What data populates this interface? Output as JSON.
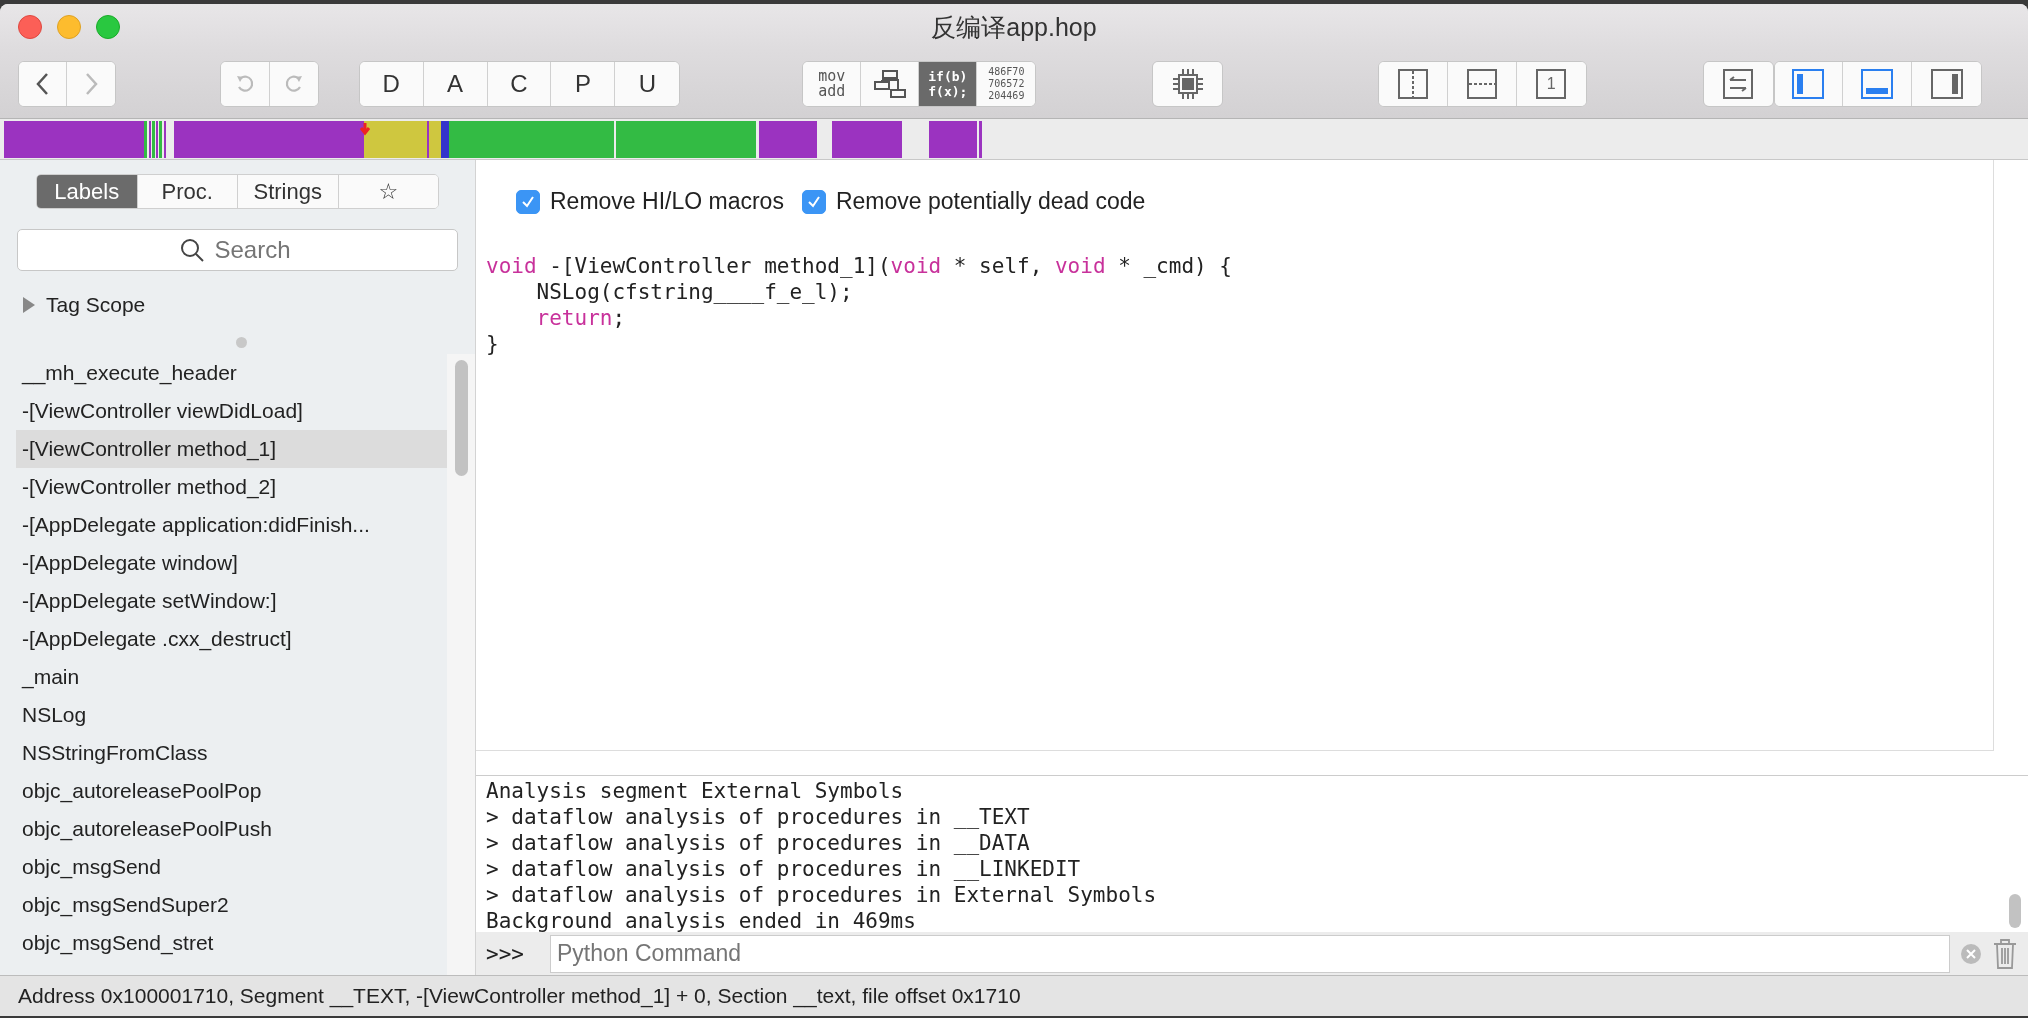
{
  "window": {
    "title": "反编译app.hop"
  },
  "toolbar": {
    "navigation": [
      {
        "kind": "back",
        "disabled": false
      },
      {
        "kind": "forward",
        "disabled": true
      }
    ],
    "history": [
      {
        "kind": "undo",
        "disabled": true
      },
      {
        "kind": "redo",
        "disabled": true
      }
    ],
    "letter_buttons": [
      "D",
      "A",
      "C",
      "P",
      "U"
    ],
    "modes": [
      {
        "kind": "asm",
        "lines": [
          "mov",
          "add"
        ],
        "selected": false
      },
      {
        "kind": "graph",
        "selected": false
      },
      {
        "kind": "pseudo",
        "lines": [
          "if(b)",
          "f(x);"
        ],
        "selected": true
      },
      {
        "kind": "hex",
        "lines": [
          "486F70",
          "706572",
          "204469"
        ],
        "selected": false
      }
    ],
    "views": [
      {
        "kind": "vsplit"
      },
      {
        "kind": "hsplit"
      },
      {
        "kind": "single",
        "label": "1"
      }
    ],
    "panels": [
      {
        "kind": "left",
        "selected": true
      },
      {
        "kind": "bottom",
        "selected": true
      },
      {
        "kind": "right",
        "selected": false
      }
    ]
  },
  "sidebar": {
    "tabs": [
      {
        "label": "Labels",
        "selected": true
      },
      {
        "label": "Proc.",
        "selected": false
      },
      {
        "label": "Strings",
        "selected": false
      },
      {
        "label": "☆",
        "selected": false
      }
    ],
    "search": {
      "placeholder": "Search"
    },
    "tag_scope": {
      "label": "Tag Scope",
      "expanded": false
    },
    "items": [
      {
        "label": "__mh_execute_header",
        "selected": false
      },
      {
        "label": "-[ViewController viewDidLoad]",
        "selected": false
      },
      {
        "label": "-[ViewController method_1]",
        "selected": true
      },
      {
        "label": "-[ViewController method_2]",
        "selected": false
      },
      {
        "label": "-[AppDelegate application:didFinish...",
        "selected": false
      },
      {
        "label": "-[AppDelegate window]",
        "selected": false
      },
      {
        "label": "-[AppDelegate setWindow:]",
        "selected": false
      },
      {
        "label": "-[AppDelegate .cxx_destruct]",
        "selected": false
      },
      {
        "label": "_main",
        "selected": false
      },
      {
        "label": "NSLog",
        "selected": false
      },
      {
        "label": "NSStringFromClass",
        "selected": false
      },
      {
        "label": "objc_autoreleasePoolPop",
        "selected": false
      },
      {
        "label": "objc_autoreleasePoolPush",
        "selected": false
      },
      {
        "label": "objc_msgSend",
        "selected": false
      },
      {
        "label": "objc_msgSendSuper2",
        "selected": false
      },
      {
        "label": "objc_msgSend_stret",
        "selected": false
      }
    ]
  },
  "editor": {
    "options": [
      {
        "label": "Remove HI/LO macros",
        "checked": true
      },
      {
        "label": "Remove potentially dead code",
        "checked": true
      }
    ],
    "code": [
      {
        "indented": false,
        "tokens": [
          {
            "kind": "keyword",
            "text": "void"
          },
          {
            "kind": "plain",
            "text": " -[ViewController method_1]("
          },
          {
            "kind": "keyword",
            "text": "void"
          },
          {
            "kind": "plain",
            "text": " * self, "
          },
          {
            "kind": "keyword",
            "text": "void"
          },
          {
            "kind": "plain",
            "text": " * _cmd) {"
          }
        ]
      },
      {
        "indented": true,
        "tokens": [
          {
            "kind": "plain",
            "text": "NSLog(cfstring____f_e_l);"
          }
        ]
      },
      {
        "indented": true,
        "tokens": [
          {
            "kind": "keyword",
            "text": "return"
          },
          {
            "kind": "plain",
            "text": ";"
          }
        ]
      },
      {
        "indented": false,
        "tokens": [
          {
            "kind": "plain",
            "text": "}"
          }
        ]
      }
    ]
  },
  "console": {
    "lines": [
      "Analysis segment External Symbols",
      "> dataflow analysis of procedures in __TEXT",
      "> dataflow analysis of procedures in __DATA",
      "> dataflow analysis of procedures in __LINKEDIT",
      "> dataflow analysis of procedures in External Symbols",
      "Background analysis ended in 469ms"
    ],
    "prompt": ">>>",
    "input": {
      "placeholder": "Python Command"
    }
  },
  "status_bar": "Address 0x100001710, Segment __TEXT, -[ViewController method_1] + 0, Section __text, file offset 0x1710"
}
